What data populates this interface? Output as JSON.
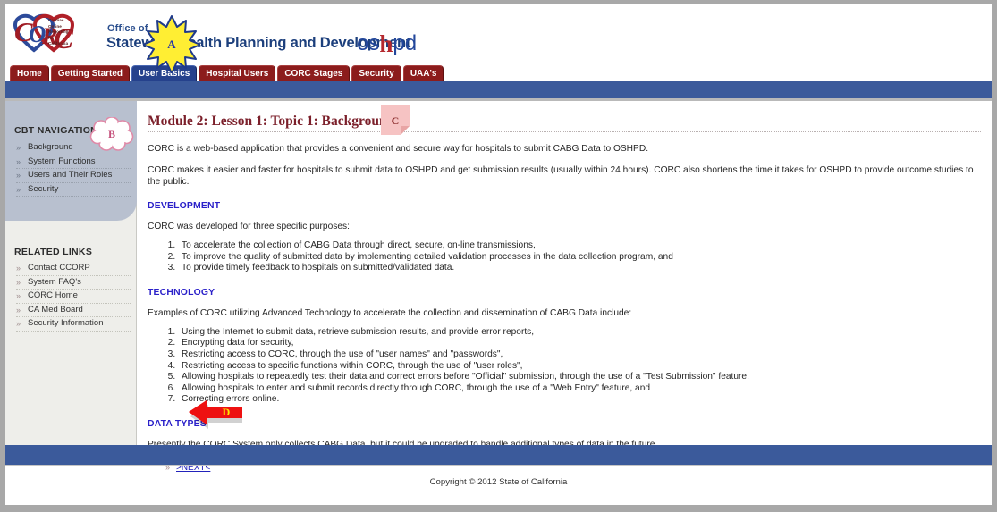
{
  "colors": {
    "tab_red": "#8c1c1c",
    "tab_active_blue": "#25418c",
    "bar_blue": "#3b5a9b",
    "heading_maroon": "#7b1f2a",
    "section_blue": "#2b21c9",
    "link_blue": "#2222bb",
    "sidebar_panel": "#b8c0cf",
    "sidebar_bg": "#eeeeea",
    "callout_a_fill": "#ffee33",
    "callout_b_fill": "#ffffff",
    "callout_b_stroke": "#e08aa8",
    "callout_c_fill": "#f6c3c3",
    "callout_d_fill": "#ee1111"
  },
  "header": {
    "logo_name": "CORC",
    "logo_tagline_lines": [
      "Cardiac",
      "Online",
      "Reporting",
      "for",
      "California"
    ],
    "office_of": "Office of",
    "department_title": "Statewide Health Planning and Development",
    "oshpd_prefix": "os",
    "oshpd_h": "h",
    "oshpd_suffix": "pd"
  },
  "nav_tabs": [
    {
      "label": "Home",
      "active": false
    },
    {
      "label": "Getting Started",
      "active": false
    },
    {
      "label": "User Basics",
      "active": true
    },
    {
      "label": "Hospital Users",
      "active": false
    },
    {
      "label": "CORC Stages",
      "active": false
    },
    {
      "label": "Security",
      "active": false
    },
    {
      "label": "UAA's",
      "active": false
    }
  ],
  "sidebar": {
    "cbt_title": "CBT NAVIGATION",
    "cbt_items": [
      {
        "label": "Background"
      },
      {
        "label": "System Functions"
      },
      {
        "label": "Users and Their Roles"
      },
      {
        "label": "Security"
      }
    ],
    "related_title": "RELATED LINKS",
    "related_items": [
      {
        "label": "Contact CCORP"
      },
      {
        "label": "System FAQ's"
      },
      {
        "label": "CORC Home"
      },
      {
        "label": "CA Med Board"
      },
      {
        "label": "Security Information"
      }
    ]
  },
  "main": {
    "page_title": "Module 2: Lesson 1: Topic 1: Background",
    "intro_paragraph_1": "CORC is a web-based application that provides a convenient and secure way for hospitals to submit CABG Data to OSHPD.",
    "intro_paragraph_2": "CORC makes it easier and faster for hospitals to submit data to OSHPD and get submission results (usually within 24 hours). CORC also shortens the time it takes for OSHPD to provide  outcome studies to the public.",
    "sections": [
      {
        "heading": "DEVELOPMENT",
        "lead": "CORC was developed for three specific purposes:",
        "items": [
          "To accelerate the collection of CABG Data through direct, secure, on-line transmissions,",
          "To improve the quality of submitted data by implementing detailed validation processes in the data collection program, and",
          "To provide timely feedback to hospitals on submitted/validated data."
        ]
      },
      {
        "heading": "TECHNOLOGY",
        "lead": "Examples of CORC utilizing Advanced Technology to accelerate the collection and dissemination of CABG Data include:",
        "items": [
          "Using the Internet to submit data, retrieve submission results, and provide error reports,",
          "Encrypting data for security,",
          "Restricting access to CORC, through the use of \"user names\" and \"passwords\",",
          "Restricting access to specific functions within CORC, through the use of \"user roles\",",
          "Allowing hospitals to repeatedly test their data and correct errors before \"Official\" submission, through the use of a \"Test Submission\" feature,",
          "Allowing hospitals to enter and submit records directly through CORC, through the use of a \"Web Entry\" feature, and",
          "Correcting errors online."
        ]
      }
    ],
    "data_types_heading": "DATA TYPES",
    "data_types_paragraph": "Presently the CORC System only collects CABG Data, but it could be upgraded to handle additional types of data in the future.",
    "next_link": ">NEXT<"
  },
  "footer": {
    "copyright": "Copyright © 2012 State of California"
  },
  "callouts": {
    "a": "A",
    "b": "B",
    "c": "C",
    "d": "D"
  }
}
